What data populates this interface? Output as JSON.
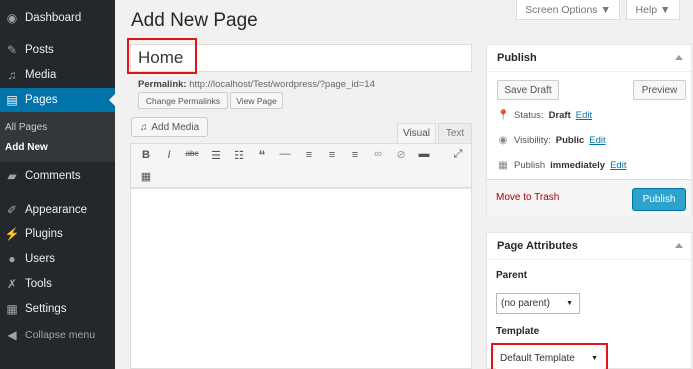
{
  "sidebar": {
    "items": [
      {
        "label": "Dashboard",
        "icon": "dashboard-icon"
      },
      {
        "label": "Posts",
        "icon": "pin-icon"
      },
      {
        "label": "Media",
        "icon": "media-icon"
      },
      {
        "label": "Pages",
        "icon": "pages-icon"
      },
      {
        "label": "Comments",
        "icon": "comment-icon"
      },
      {
        "label": "Appearance",
        "icon": "brush-icon"
      },
      {
        "label": "Plugins",
        "icon": "plug-icon"
      },
      {
        "label": "Users",
        "icon": "user-icon"
      },
      {
        "label": "Tools",
        "icon": "wrench-icon"
      },
      {
        "label": "Settings",
        "icon": "settings-icon"
      }
    ],
    "submenu": {
      "all_pages": "All Pages",
      "add_new": "Add New"
    },
    "collapse_label": "Collapse menu",
    "active_color": "#0073aa"
  },
  "top": {
    "screen_options": "Screen Options ▼",
    "help": "Help ▼"
  },
  "page_title": "Add New Page",
  "title_field": {
    "value": "Home"
  },
  "permalink": {
    "label": "Permalink:",
    "url": "http://localhost/Test/wordpress/?page_id=14",
    "change_button": "Change Permalinks",
    "view_button": "View Page"
  },
  "editor": {
    "add_media": "Add Media",
    "tab_visual": "Visual",
    "tab_text": "Text"
  },
  "publish_box": {
    "title": "Publish",
    "save_draft": "Save Draft",
    "preview": "Preview",
    "status_label": "Status:",
    "status_value": "Draft",
    "visibility_label": "Visibility:",
    "visibility_value": "Public",
    "publish_label": "Publish",
    "publish_value": "immediately",
    "edit_link": "Edit",
    "move_to_trash": "Move to Trash",
    "publish_button": "Publish",
    "publish_color": "#2ea2cc"
  },
  "attributes_box": {
    "title": "Page Attributes",
    "parent_label": "Parent",
    "parent_value": "(no parent)",
    "template_label": "Template",
    "template_value": "Default Template"
  },
  "highlight_color": "#e3131b"
}
